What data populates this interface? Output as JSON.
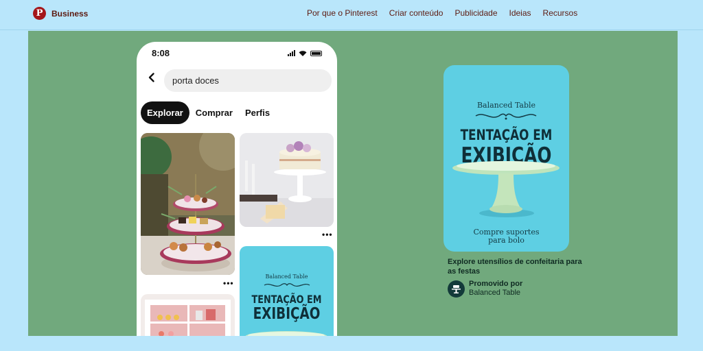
{
  "header": {
    "brand": "Business",
    "nav": [
      "Por que o Pinterest",
      "Criar conteúdo",
      "Publicidade",
      "Ideias",
      "Recursos"
    ]
  },
  "phone": {
    "time": "8:08",
    "search_value": "porta doces",
    "tabs": [
      {
        "label": "Explorar",
        "active": true
      },
      {
        "label": "Comprar",
        "active": false
      },
      {
        "label": "Perfis",
        "active": false
      }
    ],
    "more_glyph": "•••",
    "pin_promo": {
      "brand": "Balanced Table",
      "title_line1": "TENTAÇÃO EM",
      "title_line2": "EXIBIÇÃO"
    }
  },
  "promo": {
    "brand": "Balanced Table",
    "title_line1": "TENTAÇÃO EM",
    "title_line2": "EXIBIÇÃO",
    "cta_line1": "Compre suportes",
    "cta_line2": "para bolo",
    "caption": "Explore utensílios de confeitaria para as festas",
    "promoted_label": "Promovido por",
    "promoted_by": "Balanced Table"
  },
  "colors": {
    "topbar": "#b9e6fb",
    "hero": "#71a97d",
    "promo_bg": "#5ecfe3",
    "brand_red": "#a4161a"
  }
}
